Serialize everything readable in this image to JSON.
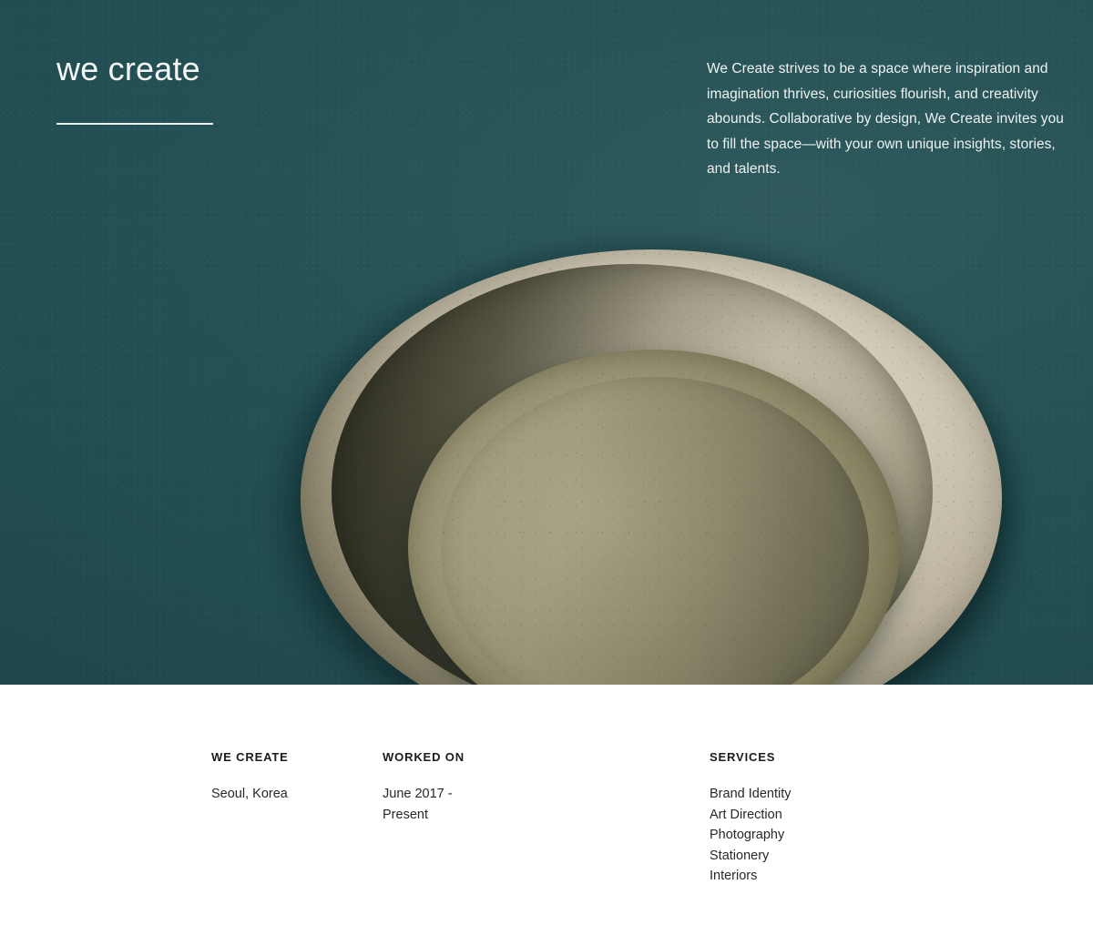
{
  "hero": {
    "background_color": "#235054",
    "headline": "we create",
    "rule": "divider-rule",
    "intro_paragraph": "We Create strives to be a space where inspiration and imagination thrives, curiosities flourish, and creativity abounds.  Collaborative by design, We Create invites you to fill the space—with your own unique insights, stories, and talents.",
    "image": {
      "subject": "stacked ceramic stoneware plates, top-down",
      "plate_colors": [
        "#cfc8b4",
        "#9e9a7b",
        "#84805f"
      ],
      "alt": "Three nested beige stoneware plates photographed from above on a dark teal paper backdrop"
    }
  },
  "footer": {
    "background_color": "#ffffff",
    "columns": [
      {
        "heading": "WE CREATE",
        "lines": [
          "Seoul, Korea"
        ]
      },
      {
        "heading": "WORKED ON",
        "lines": [
          "June 2017 -",
          "Present"
        ]
      },
      {
        "heading": "SERVICES",
        "lines": [
          "Brand Identity",
          "Art Direction",
          "Photography",
          "Stationery",
          "Interiors"
        ]
      }
    ]
  }
}
